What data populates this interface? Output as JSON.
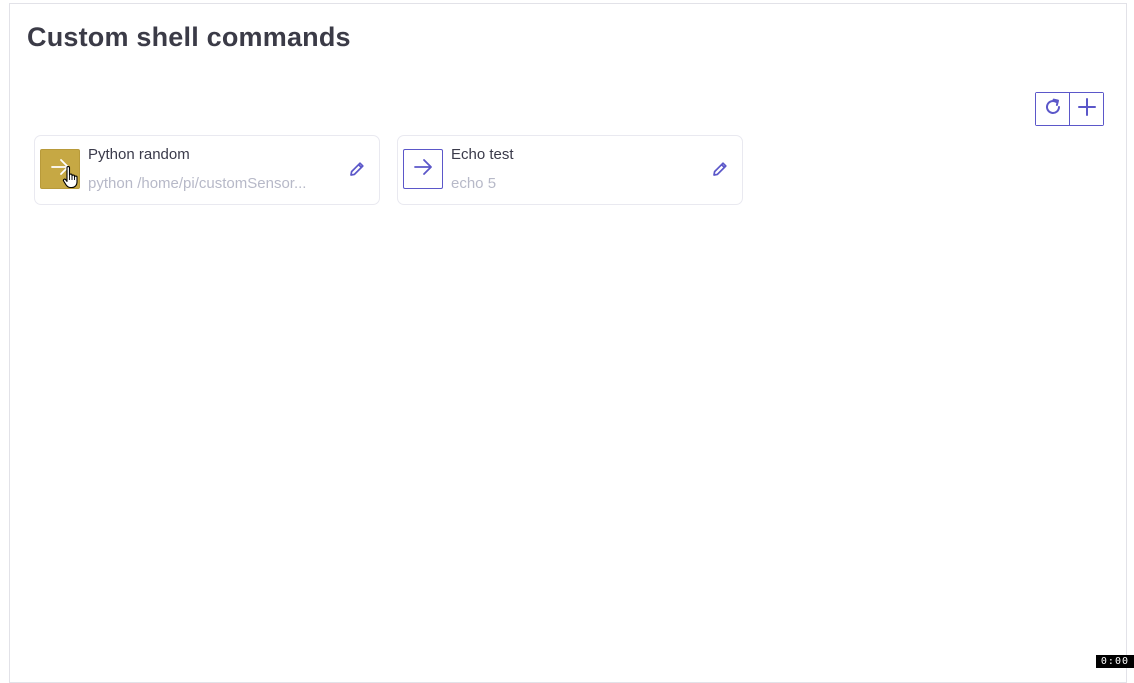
{
  "page": {
    "title": "Custom shell commands"
  },
  "toolbar": {
    "refresh_icon": "refresh-icon",
    "add_icon": "plus-icon"
  },
  "commands": [
    {
      "name": "Python random",
      "command": "python /home/pi/customSensor...",
      "run_icon": "arrow-right-icon",
      "edit_icon": "pencil-icon",
      "state": "hovered"
    },
    {
      "name": "Echo test",
      "command": "echo 5",
      "run_icon": "arrow-right-icon",
      "edit_icon": "pencil-icon",
      "state": "normal"
    }
  ],
  "recording": {
    "timer": "0:00"
  },
  "colors": {
    "accent": "#5b57c9",
    "run_active": "#c6a844",
    "muted_text": "#b7b9c8"
  }
}
